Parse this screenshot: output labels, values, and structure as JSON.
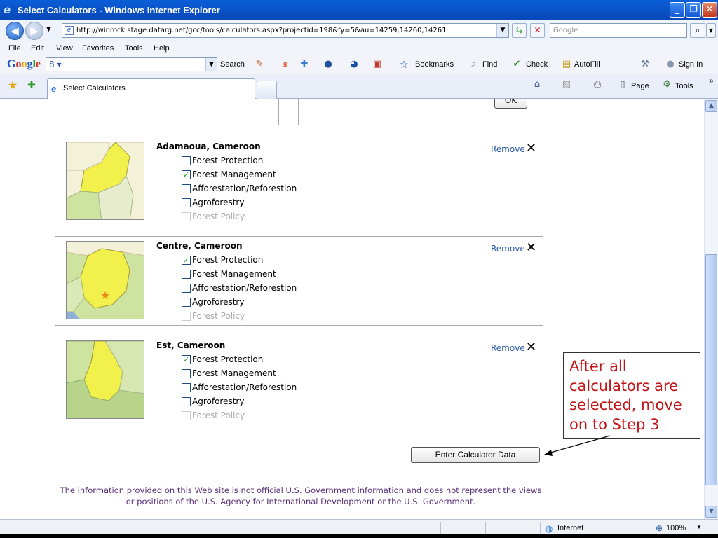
{
  "window": {
    "title": "Select Calculators - Windows Internet Explorer",
    "minimize": "_",
    "maximize": "❐",
    "close": "✕"
  },
  "address": {
    "url": "http://winrock.stage.datarg.net/gcc/tools/calculators.aspx?projectid=198&fy=5&au=14259,14260,14261",
    "search_placeholder": "Google"
  },
  "menu": [
    "File",
    "Edit",
    "View",
    "Favorites",
    "Tools",
    "Help"
  ],
  "google_toolbar": {
    "logo": "Google",
    "search_value": "8",
    "search_label": "Search",
    "bookmarks": "Bookmarks",
    "find": "Find",
    "check": "Check",
    "autofill": "AutoFill",
    "signin": "Sign In"
  },
  "tabs": {
    "active_label": "Select Calculators",
    "page_label": "Page",
    "tools_label": "Tools"
  },
  "ok_label": "OK",
  "regions": [
    {
      "name": "Adamaoua, Cameroon",
      "remove": "Remove",
      "options": [
        {
          "label": "Forest Protection",
          "checked": false,
          "disabled": false
        },
        {
          "label": "Forest Management",
          "checked": true,
          "disabled": false
        },
        {
          "label": "Afforestation/Reforestion",
          "checked": false,
          "disabled": false
        },
        {
          "label": "Agroforestry",
          "checked": false,
          "disabled": false
        },
        {
          "label": "Forest Policy",
          "checked": false,
          "disabled": true
        }
      ]
    },
    {
      "name": "Centre, Cameroon",
      "remove": "Remove",
      "options": [
        {
          "label": "Forest Protection",
          "checked": true,
          "disabled": false
        },
        {
          "label": "Forest Management",
          "checked": false,
          "disabled": false
        },
        {
          "label": "Afforestation/Reforestion",
          "checked": false,
          "disabled": false
        },
        {
          "label": "Agroforestry",
          "checked": false,
          "disabled": false
        },
        {
          "label": "Forest Policy",
          "checked": false,
          "disabled": true
        }
      ]
    },
    {
      "name": "Est, Cameroon",
      "remove": "Remove",
      "options": [
        {
          "label": "Forest Protection",
          "checked": true,
          "disabled": false
        },
        {
          "label": "Forest Management",
          "checked": false,
          "disabled": false
        },
        {
          "label": "Afforestation/Reforestion",
          "checked": false,
          "disabled": false
        },
        {
          "label": "Agroforestry",
          "checked": false,
          "disabled": false
        },
        {
          "label": "Forest Policy",
          "checked": false,
          "disabled": true
        }
      ]
    }
  ],
  "enter_button": "Enter Calculator Data",
  "disclaimer": "The information provided on this Web site is not official U.S. Government information and does not represent the views or positions of the U.S. Agency for International Development or the U.S. Government.",
  "callout": "After all calculators are selected, move on to Step 3",
  "status": {
    "zone": "Internet",
    "zoom": "100%"
  },
  "colors": {
    "map_highlight": "#f2f04a",
    "map_land": "#cfe3a0",
    "map_other": "#f2f0d6",
    "callout_text": "#c0171a",
    "link": "#2a5aa5"
  }
}
